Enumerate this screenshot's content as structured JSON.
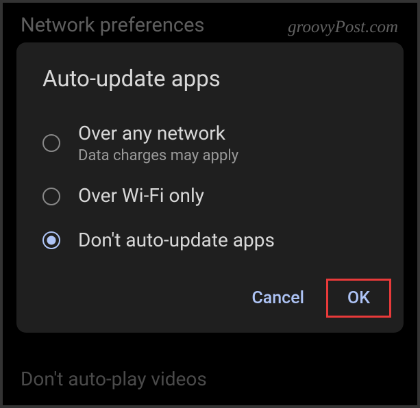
{
  "background": {
    "header": "Network preferences",
    "footer": "Don't auto-play videos"
  },
  "watermark": "groovyPost.com",
  "dialog": {
    "title": "Auto-update apps",
    "options": [
      {
        "label": "Over any network",
        "sublabel": "Data charges may apply",
        "selected": false
      },
      {
        "label": "Over Wi-Fi only",
        "sublabel": "",
        "selected": false
      },
      {
        "label": "Don't auto-update apps",
        "sublabel": "",
        "selected": true
      }
    ],
    "actions": {
      "cancel": "Cancel",
      "ok": "OK"
    }
  }
}
